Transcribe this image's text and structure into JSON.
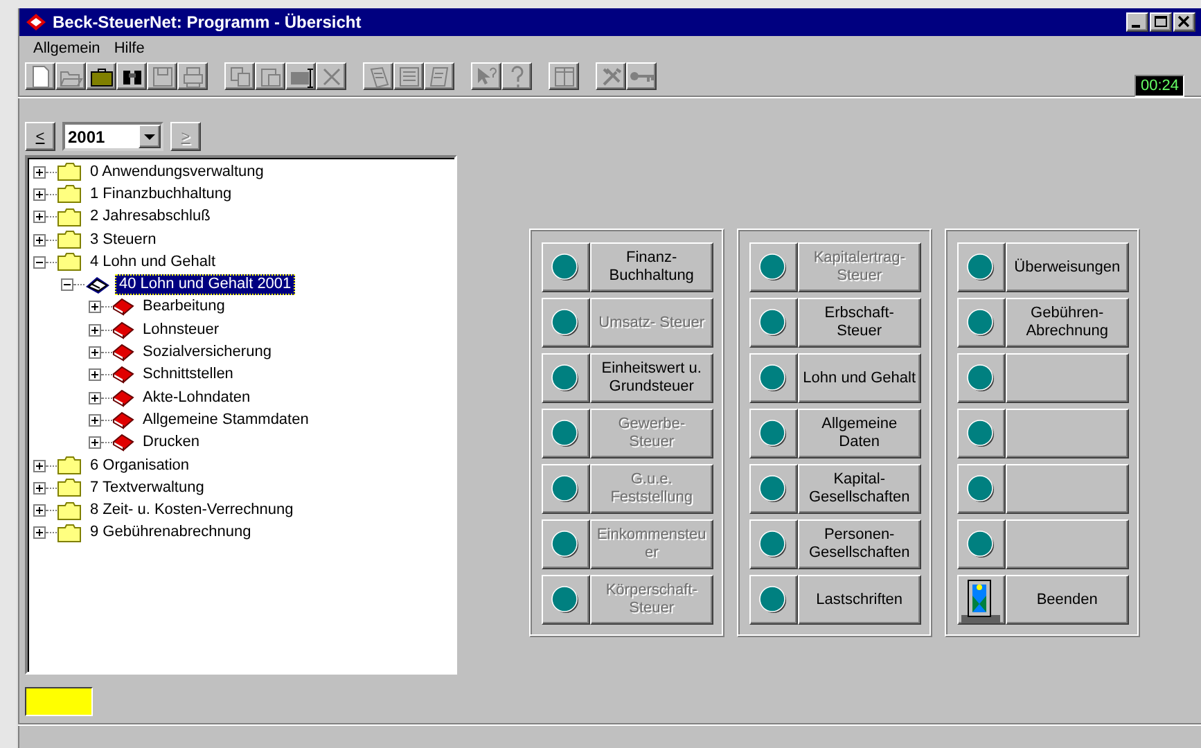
{
  "window": {
    "title": "Beck-SteuerNet: Programm - Übersicht"
  },
  "menu": [
    {
      "label": "Allgemein"
    },
    {
      "label": "Hilfe"
    }
  ],
  "clock": "00:24",
  "year_selector": {
    "prev": "<",
    "value": "2001",
    "next": ">",
    "next_disabled": true
  },
  "tree": [
    {
      "label": "0 Anwendungsverwaltung",
      "kind": "folder",
      "expanded": false,
      "selected": false
    },
    {
      "label": "1 Finanzbuchhaltung",
      "kind": "folder",
      "expanded": false,
      "selected": false
    },
    {
      "label": "2 Jahresabschluß",
      "kind": "folder",
      "expanded": false,
      "selected": false
    },
    {
      "label": "3 Steuern",
      "kind": "folder",
      "expanded": false,
      "selected": false
    },
    {
      "label": "4 Lohn und Gehalt",
      "kind": "folder",
      "expanded": true,
      "selected": false,
      "children": [
        {
          "label": "40 Lohn und Gehalt 2001",
          "kind": "books",
          "expanded": true,
          "selected": true,
          "children": [
            {
              "label": "Bearbeitung",
              "kind": "book",
              "expanded": false,
              "selected": false
            },
            {
              "label": "Lohnsteuer",
              "kind": "book",
              "expanded": false,
              "selected": false
            },
            {
              "label": "Sozialversicherung",
              "kind": "book",
              "expanded": false,
              "selected": false
            },
            {
              "label": "Schnittstellen",
              "kind": "book",
              "expanded": false,
              "selected": false
            },
            {
              "label": "Akte-Lohndaten",
              "kind": "book",
              "expanded": false,
              "selected": false
            },
            {
              "label": "Allgemeine Stammdaten",
              "kind": "book",
              "expanded": false,
              "selected": false
            },
            {
              "label": "Drucken",
              "kind": "book",
              "expanded": false,
              "selected": false
            }
          ]
        }
      ]
    },
    {
      "label": "6 Organisation",
      "kind": "folder",
      "expanded": false,
      "selected": false
    },
    {
      "label": "7 Textverwaltung",
      "kind": "folder",
      "expanded": false,
      "selected": false
    },
    {
      "label": "8 Zeit- u. Kosten-Verrechnung",
      "kind": "folder",
      "expanded": false,
      "selected": false
    },
    {
      "label": "9 Gebührenabrechnung",
      "kind": "folder",
      "expanded": false,
      "selected": false
    }
  ],
  "panels": [
    [
      {
        "kind": "led",
        "label": "Finanz-\nBuchhaltung",
        "disabled": false
      },
      {
        "kind": "led",
        "label": "Umsatz- Steuer",
        "disabled": true
      },
      {
        "kind": "led",
        "label": "Einheitswert u.\nGrundsteuer",
        "disabled": false
      },
      {
        "kind": "led",
        "label": "Gewerbe- Steuer",
        "disabled": true
      },
      {
        "kind": "led",
        "label": "G.u.e.\nFeststellung",
        "disabled": true
      },
      {
        "kind": "led",
        "label": "Einkommensteu\ner",
        "disabled": true
      },
      {
        "kind": "led",
        "label": "Körperschaft-\nSteuer",
        "disabled": true
      }
    ],
    [
      {
        "kind": "led",
        "label": "Kapitalertrag-\nSteuer",
        "disabled": true
      },
      {
        "kind": "led",
        "label": "Erbschaft-\nSteuer",
        "disabled": false
      },
      {
        "kind": "led",
        "label": "Lohn und Gehalt",
        "disabled": false
      },
      {
        "kind": "led",
        "label": "Allgemeine\nDaten",
        "disabled": false
      },
      {
        "kind": "led",
        "label": "Kapital-\nGesellschaften",
        "disabled": false
      },
      {
        "kind": "led",
        "label": "Personen-\nGesellschaften",
        "disabled": false
      },
      {
        "kind": "led",
        "label": "Lastschriften",
        "disabled": false
      }
    ],
    [
      {
        "kind": "led",
        "label": "Überweisungen",
        "disabled": false
      },
      {
        "kind": "led",
        "label": "Gebühren-\nAbrechnung",
        "disabled": false
      },
      {
        "kind": "blank"
      },
      {
        "kind": "blank"
      },
      {
        "kind": "blank"
      },
      {
        "kind": "blank"
      },
      {
        "kind": "exit",
        "label": "Beenden",
        "disabled": false
      }
    ]
  ]
}
